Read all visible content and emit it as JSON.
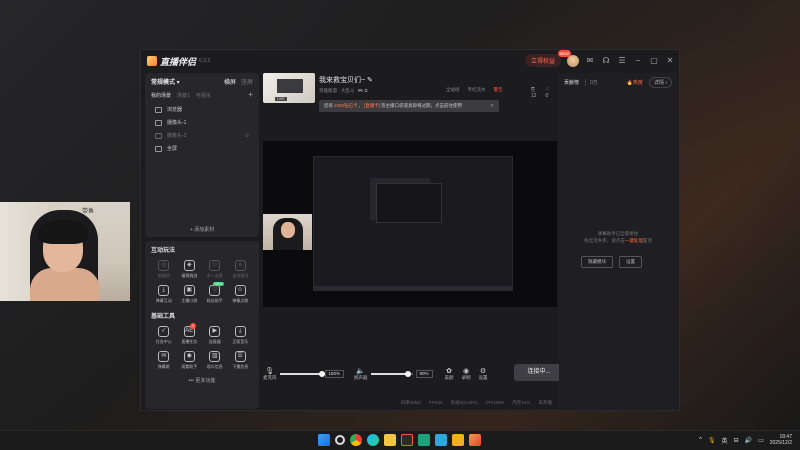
{
  "app": {
    "name": "直播伴侣",
    "version": "6.3.2",
    "upgrade": "立得权益",
    "upgrade_badge": "NEW"
  },
  "webcam_tag": "带鱼",
  "left_panel": {
    "mode": "常规模式",
    "orient_landscape": "横屏",
    "orient_portrait": "竖屏",
    "scene_tabs": [
      "我的场景",
      "场景1",
      "可视化"
    ],
    "sources": [
      {
        "label": "浏览器",
        "dim": false
      },
      {
        "label": "摄像头-1",
        "dim": false
      },
      {
        "label": "摄像头-2",
        "dim": true
      },
      {
        "label": "全屏",
        "dim": false
      }
    ],
    "add_source": "+ 添加素材"
  },
  "interactive": {
    "title": "互动玩法",
    "items": [
      {
        "label": "抢福袋",
        "icon": "◎",
        "dim": true
      },
      {
        "label": "福袋挑战",
        "icon": "◈",
        "dim": false
      },
      {
        "label": "多人连麦",
        "icon": "⚇",
        "dim": true
      },
      {
        "label": "连线挑战",
        "icon": "⚔",
        "dim": true
      },
      {
        "label": "弹幕互动",
        "icon": "⤓",
        "dim": false
      },
      {
        "label": "主播口袋",
        "icon": "▣",
        "dim": false
      },
      {
        "label": "粉丝助手",
        "icon": "♡",
        "dim": false,
        "new": "NEW"
      },
      {
        "label": "弹幕点歌",
        "icon": "☺",
        "dim": false
      }
    ],
    "tools_title": "基础工具",
    "tools": [
      {
        "label": "任务中心",
        "icon": "✓"
      },
      {
        "label": "直播任务",
        "icon": "AE",
        "dot": "1"
      },
      {
        "label": "连接器",
        "icon": "▶"
      },
      {
        "label": "正版音乐",
        "icon": "⤓"
      },
      {
        "label": "弹幕姬",
        "icon": "✉"
      },
      {
        "label": "观看助手",
        "icon": "◉"
      },
      {
        "label": "观众信息",
        "icon": "▥"
      },
      {
        "label": "下播信息",
        "icon": "☰"
      }
    ],
    "more": "••• 更多功能"
  },
  "live": {
    "title": "我来救宝贝们~",
    "sub": "英雄联盟 · 大乱斗",
    "notice_prefix": "您有",
    "notice_hl1": "1000钻石卡",
    "notice_mid": "、",
    "notice_hl2": "[直播卡]",
    "notice_suffix": "等主播口袋道具即将过期，点击前往使用",
    "stats": [
      "全站榜",
      "专栏流水"
    ],
    "warn": "警告",
    "likes": "12",
    "hearts": "0"
  },
  "controls": {
    "mic": "麦克风",
    "mic_pct": "150%",
    "mic_level": 1.0,
    "speaker": "扬声器",
    "speaker_pct": "90%",
    "speaker_level": 0.9,
    "beauty": "美颜",
    "record": "录制",
    "settings": "设置",
    "live_btn": "连接中..."
  },
  "status": [
    "码率0kb/s",
    "FPS60",
    "丢帧0(0.00%)",
    "CPU29%",
    "内存44%",
    "未开播"
  ],
  "right_panel": {
    "title": "贡献榜",
    "count": "0万",
    "hot": "热度",
    "detail": "详情 ›",
    "msg1": "弹幕助手已全部接住",
    "msg2_prefix": "粉丝流失率，请点击",
    "msg2_link": "一键处理",
    "msg2_suffix": "置顶",
    "btn1": "隐藏模块",
    "btn2": "设置"
  },
  "taskbar": {
    "lang": "英",
    "time": "18:47",
    "date": "2025/12/2"
  }
}
